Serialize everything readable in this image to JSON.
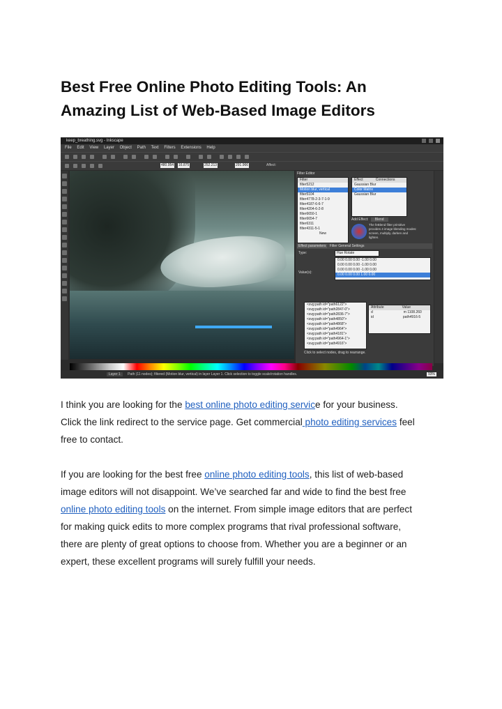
{
  "article": {
    "title_line1": "Best Free Online Photo Editing Tools: An",
    "title_line2": "Amazing List of Web-Based Image Editors",
    "p1": {
      "l1_before": "I think you are looking for the ",
      "l1_link": "best online photo editing servic",
      "l1_after": "e for your business.",
      "l2_before": "Click the link redirect to the service page. Get commercial",
      "l2_link": " photo editing services",
      "l2_after": " feel",
      "l3": "free to contact."
    },
    "p2": {
      "l1_before": "If you are looking for the best free ",
      "l1_link": "online photo editing tools",
      "l1_after": ", this list of web-based",
      "l2": "image editors will not disappoint. We’ve searched far and wide to find the best free",
      "l3_link": "online photo editing tools",
      "l3_after": " on the internet. From simple image editors that are perfect",
      "l4": "for making quick edits to more complex programs that rival professional software,",
      "l5": "there are plenty of great options to choose from. Whether you are a beginner or an",
      "l6": "expert, these excellent programs will surely fulfill your needs."
    }
  },
  "screenshot": {
    "window_title": "keep_breathing.svg - Inkscape",
    "menu": [
      "File",
      "Edit",
      "View",
      "Layer",
      "Object",
      "Path",
      "Text",
      "Filters",
      "Extensions",
      "Help"
    ],
    "fields": [
      "480.954",
      "16.875",
      "252.213",
      "291.966"
    ],
    "affect_label": "Affect:",
    "filter_editor_title": "Filter Editor",
    "filter_header": "Filter",
    "filters": [
      "filter5212",
      "Motion blur, vertical",
      "filter5104",
      "filter4778-2-3-7-1-9",
      "filter4187-6-6-7",
      "filter4204-6-2-8",
      "filter6650-1",
      "filter6654-7",
      "filter6311",
      "filter4311-5-1"
    ],
    "new_label": "New",
    "effect_header": "Effect",
    "connections_header": "Connections",
    "effects": [
      "Gaussian Blur",
      "Color Matrix",
      "Gaussian Blur"
    ],
    "add_effect_label": "Add Effect:",
    "add_effect_value": "Blend",
    "blend_desc": "The feBlend filter primitive provides 4 image blending modes: screen, multiply, darken and lighten.",
    "tab_effect_params": "Effect parameters",
    "tab_general": "Filter General Settings",
    "type_label": "Type:",
    "type_value": "Hue Rotate",
    "values_label": "Value(s):",
    "matrix_rows": [
      "0.00  0.00  0.00  -1.00  0.00",
      "0.00  0.00  0.00  -1.00  0.00",
      "0.00  0.00  0.00  -1.00  0.00",
      "0.00  0.00  0.00  1.00  0.00"
    ],
    "xml_nodes": [
      "<svg:path id=\"path6122\">",
      "<svg:path id=\"path2847-0\">",
      "<svg:path id=\"path2836-7\">",
      "<svg:path id=\"path4850\">",
      "<svg:path id=\"path4868\">",
      "<svg:path id=\"path4964\">",
      "<svg:path id=\"path4181\">",
      "<svg:path id=\"path4964-1\">",
      "<svg:path id=\"path4916\">"
    ],
    "attr_header": "Attribute",
    "value_header": "Value",
    "attr_rows": [
      {
        "k": "d",
        "v": "m 1108.260"
      },
      {
        "k": "id",
        "v": "path4916-5"
      }
    ],
    "xml_hint": "Click to select nodes, drag to rearrange.",
    "status_layer": "Layer 1",
    "status_text": "Path (11 nodes); filtered (Motion blur, vertical) in layer Layer 1. Click selection to toggle scale/rotation handles.",
    "zoom": "93%"
  }
}
